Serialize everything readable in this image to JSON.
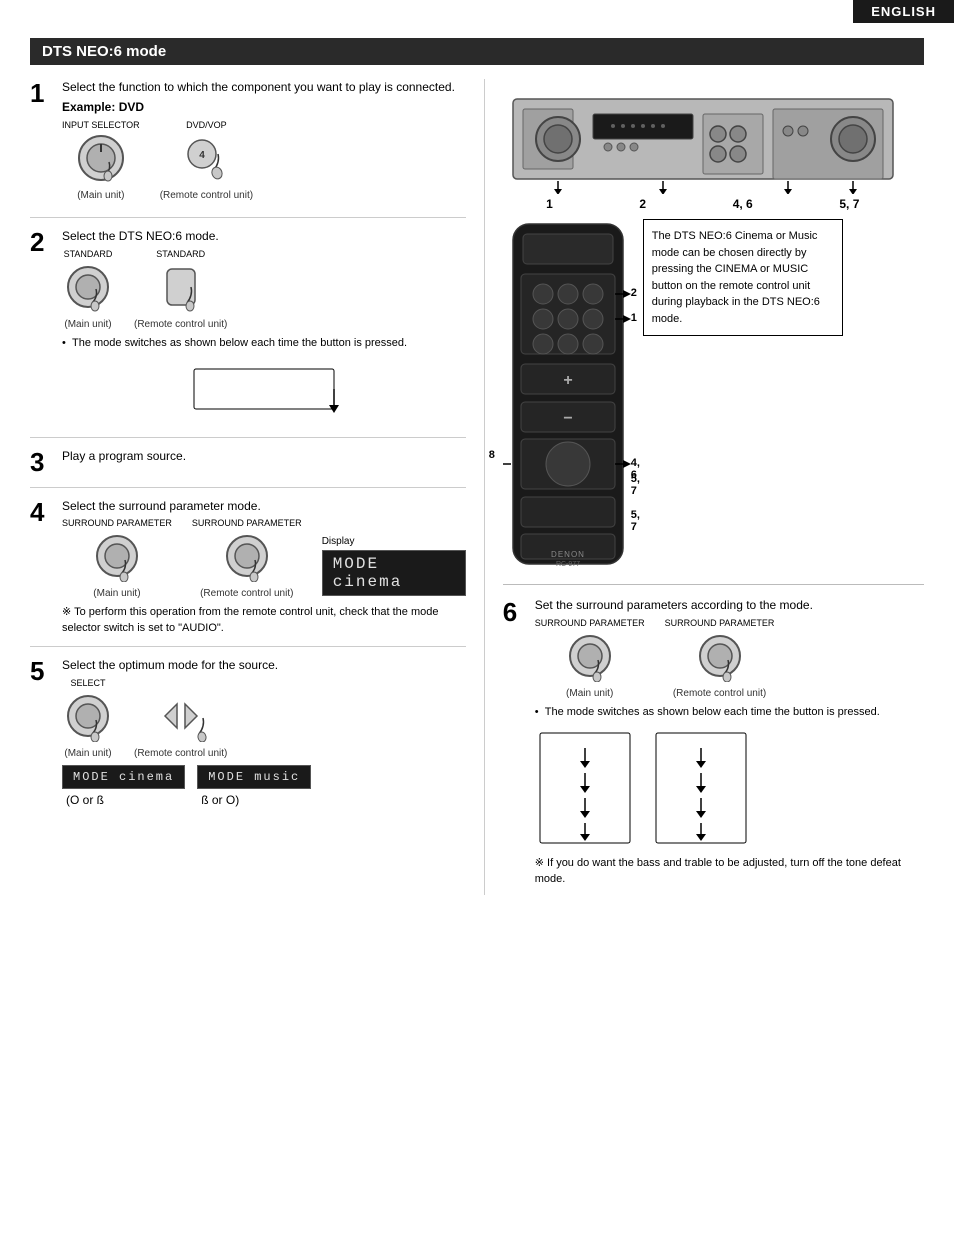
{
  "header": {
    "language": "ENGLISH",
    "section_title": "DTS NEO:6 mode"
  },
  "steps": {
    "step1": {
      "number": "1",
      "text": "Select the function to which the component you want to play is connected.",
      "example_label": "Example: DVD",
      "main_unit_label": "(Main unit)",
      "remote_label": "(Remote control unit)"
    },
    "step2": {
      "number": "2",
      "text": "Select the DTS NEO:6 mode.",
      "main_unit_label": "(Main unit)",
      "remote_label": "(Remote control unit)",
      "bullet": "The mode switches as shown below each time the button is pressed."
    },
    "step3": {
      "number": "3",
      "text": "Play a program source."
    },
    "step4": {
      "number": "4",
      "text": "Select the surround parameter mode.",
      "main_unit_label": "(Main unit)",
      "remote_label": "(Remote control unit)",
      "display_label": "Display",
      "display_text": "MODE  cinema",
      "note": "※ To perform this operation from the remote control unit, check that the mode selector switch is set to \"AUDIO\"."
    },
    "step5": {
      "number": "5",
      "text": "Select the optimum mode for the source.",
      "main_unit_label": "(Main unit)",
      "remote_label": "(Remote control unit)",
      "mode1_line1": "MODE  cinema",
      "mode1_line2": "(O or ß",
      "mode2_line1": "MODE  music",
      "mode2_line2": "ß or O)"
    },
    "step6_right": {
      "number": "6",
      "text": "Set the surround parameters according to the mode.",
      "main_unit_label": "(Main unit)",
      "remote_label": "(Remote control unit)",
      "bullet": "The mode switches as shown below each time the button is pressed.",
      "note": "※ If you do want the bass and trable to be adjusted, turn off the tone defeat mode."
    }
  },
  "callout": {
    "text": "The DTS NEO:6 Cinema or Music mode can be chosen directly by pressing the CINEMA or MUSIC button on the remote control unit during playback in the DTS NEO:6 mode."
  },
  "device_labels": {
    "label1": "1",
    "label2": "2",
    "label3": "4, 6",
    "label4": "5, 7"
  },
  "remote_labels": {
    "label1": "2",
    "label2": "1",
    "label3": "4, 6",
    "label4": "8",
    "label5": "5, 7",
    "label6": "5, 7"
  },
  "knob_labels": {
    "input_selector": "INPUT SELECTOR",
    "dvd_vop": "DVD/VOP",
    "standard_main": "STANDARD",
    "standard_remote": "STANDARD",
    "surround_param_main": "SURROUND PARAMETER",
    "surround_param_remote": "SURROUND PARAMETER",
    "select": "SELECT"
  }
}
